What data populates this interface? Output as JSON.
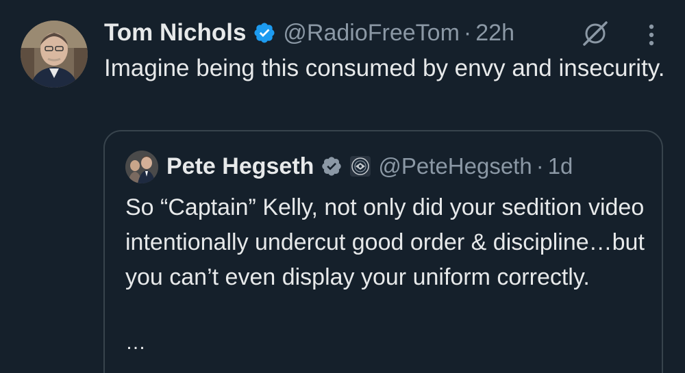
{
  "tweet": {
    "name": "Tom Nichols",
    "handle": "@RadioFreeTom",
    "separator": "·",
    "time": "22h",
    "text": "Imagine being this consumed by envy and insecurity.",
    "icons": {
      "verified": "verified-badge-icon",
      "grok": "grok-icon",
      "more": "more-options-icon"
    }
  },
  "quote": {
    "name": "Pete Hegseth",
    "handle": "@PeteHegseth",
    "separator": "·",
    "time": "1d",
    "text": "So “Captain” Kelly, not only did your sedition video intentionally undercut good order & discipline…but you can’t even display your uniform correctly.",
    "truncation": "…",
    "icons": {
      "verified": "verified-badge-icon",
      "affiliation": "affiliation-seal-icon"
    }
  },
  "colors": {
    "background": "#15202b",
    "text": "#e7e9ea",
    "secondary": "#8b98a5",
    "verified": "#1d9bf0",
    "border": "#38444d"
  }
}
